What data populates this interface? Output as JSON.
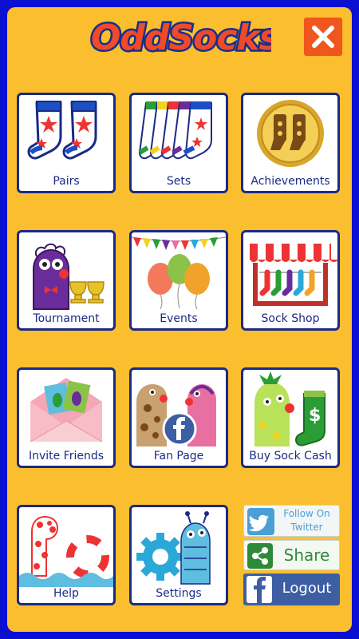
{
  "app": {
    "logo_text": "OddSocks"
  },
  "header": {
    "close_icon": "close-icon"
  },
  "tiles": [
    {
      "label": "Pairs",
      "icon": "pairs-socks-icon"
    },
    {
      "label": "Sets",
      "icon": "sets-socks-icon"
    },
    {
      "label": "Achievements",
      "icon": "achievements-medal-icon"
    },
    {
      "label": "Tournament",
      "icon": "tournament-trophy-icon"
    },
    {
      "label": "Events",
      "icon": "events-balloons-icon"
    },
    {
      "label": "Sock Shop",
      "icon": "sock-shop-icon"
    },
    {
      "label": "Invite Friends",
      "icon": "invite-envelope-icon"
    },
    {
      "label": "Fan Page",
      "icon": "fan-page-facebook-icon"
    },
    {
      "label": "Buy Sock Cash",
      "icon": "buy-sock-cash-icon"
    },
    {
      "label": "Help",
      "icon": "help-lifebuoy-icon"
    },
    {
      "label": "Settings",
      "icon": "settings-gear-icon"
    }
  ],
  "side_buttons": {
    "twitter": {
      "line1": "Follow On",
      "line2": "Twitter",
      "icon": "twitter-bird-icon"
    },
    "share": {
      "label": "Share",
      "icon": "share-icon"
    },
    "logout": {
      "label": "Logout",
      "icon": "facebook-f-icon"
    }
  },
  "colors": {
    "background": "#fbbe2f",
    "frame": "#0a0fd0",
    "tile_border": "#1b2a86",
    "close_button": "#f0561e",
    "logout_button": "#3d5ea3",
    "share_green": "#2d8a3a",
    "twitter_blue": "#4a9fd4"
  }
}
